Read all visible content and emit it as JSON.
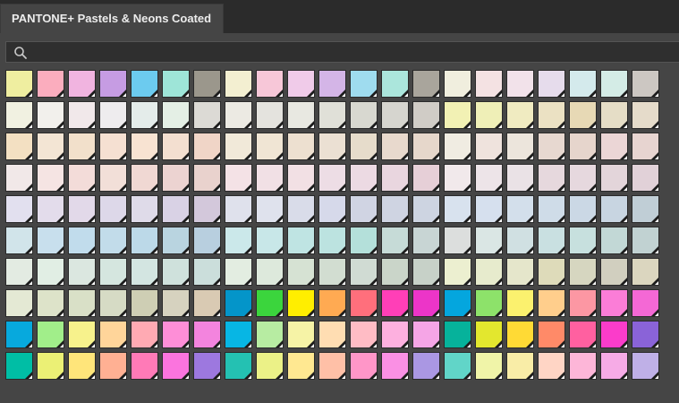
{
  "tab": {
    "title": "PANTONE+ Pastels & Neons Coated"
  },
  "search": {
    "placeholder": "",
    "value": ""
  },
  "swatch_rows": [
    [
      "#efeea0",
      "#fbadbe",
      "#f1b4e0",
      "#c69ce3",
      "#6ccbef",
      "#9ee5d8",
      "#9b978c",
      "#f3efd1",
      "#f7c7d8",
      "#f0cbe9",
      "#d4b5e7",
      "#9fdcef",
      "#abe6dc",
      "#a9a59c",
      "#f0eede",
      "#f4e2e3",
      "#f2e2ea",
      "#e6dcec",
      "#d4eaec",
      "#d4ece6",
      "#ccc7c2"
    ],
    [
      "#f1f1e1",
      "#f2f0ec",
      "#f1e8ea",
      "#eeecee",
      "#e4ecea",
      "#e4efe5",
      "#dcdad5",
      "#eceae3",
      "#e4e3de",
      "#e8e8e1",
      "#e0e0d8",
      "#d8d8d0",
      "#d6d5cf",
      "#d0ccc6",
      "#f2f1b4",
      "#efefb7",
      "#f0ebc1",
      "#ebe1c3",
      "#e7d9b5",
      "#e5ddc6",
      "#e5dbca"
    ],
    [
      "#f3e0c2",
      "#f3e5d4",
      "#f2e0cb",
      "#f5e0d2",
      "#f8e3d2",
      "#f3dfd0",
      "#f0d5c7",
      "#f1e9d9",
      "#f0e5d4",
      "#ede0d0",
      "#ebe0d3",
      "#e6dccb",
      "#e8d9cd",
      "#e6d7cb",
      "#f0ece2",
      "#efe3dd",
      "#ece5dc",
      "#e7d8d0",
      "#e6d5cc",
      "#ebd6d6",
      "#e7d4d0"
    ],
    [
      "#f1e8e8",
      "#f5e4e3",
      "#f3dcd9",
      "#f2dfd8",
      "#f0d8d3",
      "#ecd3d1",
      "#e9d2cd",
      "#f4e2e6",
      "#f1e0e5",
      "#f2e0e4",
      "#eddde5",
      "#ecdae3",
      "#e9d6df",
      "#e6cfd7",
      "#f1e9eb",
      "#ede4e8",
      "#eae2e6",
      "#e6d8dd",
      "#e6d8de",
      "#e3d5da",
      "#e1d1d8"
    ],
    [
      "#e2e0ef",
      "#e3dceb",
      "#e2d9e9",
      "#ddd8e9",
      "#dfdbe9",
      "#d9d2e5",
      "#d3c8db",
      "#dfe1ec",
      "#dfe2ed",
      "#d9dce9",
      "#d6d9ea",
      "#d0d4e3",
      "#cfd4e2",
      "#cdd4e1",
      "#d8e2ee",
      "#d6e0ee",
      "#d3dfeb",
      "#cfdce8",
      "#cbd8e5",
      "#c8d5e1",
      "#c0ced6"
    ],
    [
      "#d1e4ea",
      "#c8dfed",
      "#c1dcec",
      "#c2dcea",
      "#bcd9e8",
      "#b9d4e0",
      "#b8cfdf",
      "#cbe8ea",
      "#c8e7e8",
      "#bfe4e3",
      "#bce3e0",
      "#b4e0da",
      "#c6dbd7",
      "#c8d5d4",
      "#dcdedd",
      "#dae6e4",
      "#d0e0e2",
      "#c9e0e1",
      "#c7e0de",
      "#c2d8d6",
      "#c1d2d2"
    ],
    [
      "#e3ebe2",
      "#e1eee4",
      "#dbe7e0",
      "#d5e6df",
      "#d3e5e1",
      "#cfe1dc",
      "#cbdedb",
      "#e3ede1",
      "#dde9dc",
      "#d6e2d3",
      "#d2ddd1",
      "#d0dbd3",
      "#cad5c9",
      "#c7d1c8",
      "#ecefd0",
      "#e7ebcd",
      "#e5e6cb",
      "#dedbba",
      "#d6d6c0",
      "#d1cfbf",
      "#dbd6bf"
    ],
    [
      "#e4e9d4",
      "#dde3c9",
      "#d9e0c7",
      "#d6dbc5",
      "#ceceb4",
      "#d6d2bf",
      "#d9cab3",
      "#0495c9",
      "#3bd53d",
      "#ffee00",
      "#ffaa52",
      "#ff6f7c",
      "#ff3fb7",
      "#ec35c8",
      "#04a6de",
      "#8de26a",
      "#fbf16e",
      "#ffce8c",
      "#fc97a3",
      "#fb7dd7",
      "#f468d5"
    ],
    [
      "#07a9dd",
      "#a1ee8a",
      "#f7f28c",
      "#ffd59a",
      "#ffaab3",
      "#fe8ed7",
      "#f384de",
      "#07b6e4",
      "#b7eca2",
      "#f6f3a6",
      "#ffddb2",
      "#ffbcc5",
      "#fdb0df",
      "#f5a5e6",
      "#06b29b",
      "#e3e72e",
      "#ffda35",
      "#ff8a68",
      "#ff60a0",
      "#fb3cca",
      "#8a63d8"
    ],
    [
      "#00bea5",
      "#ebf075",
      "#ffe57a",
      "#ffb093",
      "#ff7ab7",
      "#fb74de",
      "#9d78df",
      "#24c1b2",
      "#ebf187",
      "#ffe891",
      "#ffc0a7",
      "#ff96c8",
      "#fa90e4",
      "#aa97e3",
      "#61d5c8",
      "#f0f4a8",
      "#f9eda7",
      "#ffd5c5",
      "#fdb6d8",
      "#f6abe6",
      "#bfb0e7"
    ]
  ]
}
